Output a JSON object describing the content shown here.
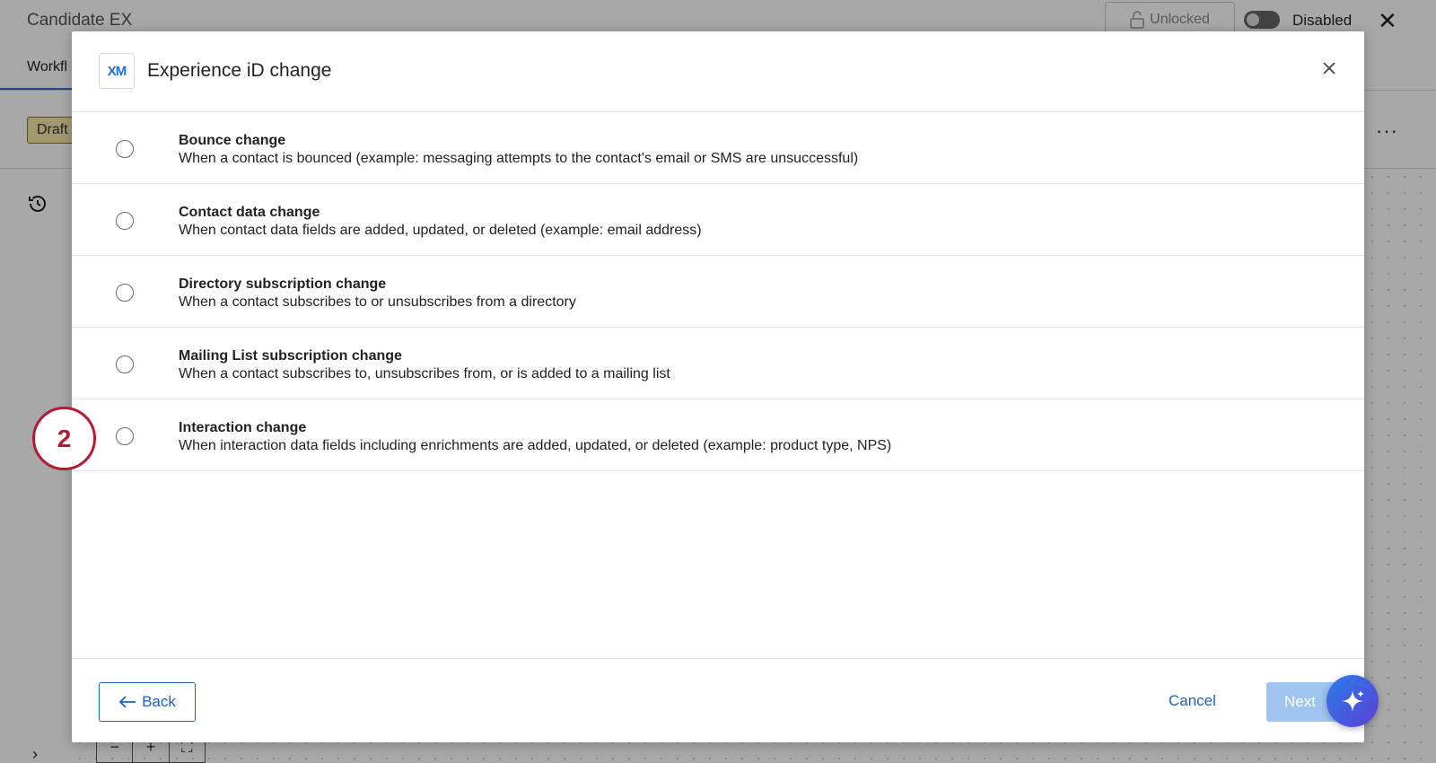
{
  "background": {
    "app_title": "Candidate EX",
    "lock_label": "Unlocked",
    "toggle_label": "Disabled",
    "tab_label": "Workfl",
    "status_badge": "Draft",
    "more_label": "···"
  },
  "modal": {
    "logo_text": "XM",
    "title": "Experience iD change",
    "options": [
      {
        "title": "Bounce change",
        "description": "When a contact is bounced (example: messaging attempts to the contact's email or SMS are unsuccessful)"
      },
      {
        "title": "Contact data change",
        "description": "When contact data fields are added, updated, or deleted (example: email address)"
      },
      {
        "title": "Directory subscription change",
        "description": "When a contact subscribes to or unsubscribes from a directory"
      },
      {
        "title": "Mailing List subscription change",
        "description": "When a contact subscribes to, unsubscribes from, or is added to a mailing list"
      },
      {
        "title": "Interaction change",
        "description": "When interaction data fields including enrichments are added, updated, or deleted (example: product type, NPS)"
      }
    ],
    "step_number": "2",
    "footer": {
      "back_label": "Back",
      "cancel_label": "Cancel",
      "next_label": "Next"
    }
  },
  "colors": {
    "accent": "#1e5fbf",
    "step_badge": "#b31b34",
    "next_disabled": "#9fc4ef"
  }
}
